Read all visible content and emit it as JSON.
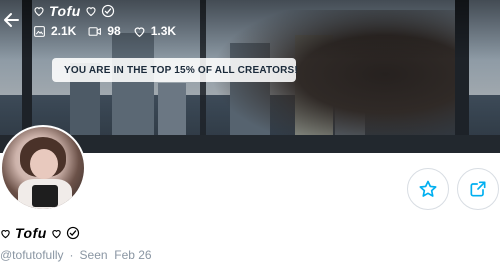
{
  "header": {
    "display_name": "Tofu",
    "stats": {
      "photos": "2.1K",
      "videos": "98",
      "likes": "1.3K"
    }
  },
  "banner": {
    "rank_text": "YOU ARE IN THE TOP 15% OF ALL CREATORS!"
  },
  "profile": {
    "display_name": "Tofu",
    "username": "@tofutofully",
    "separator": "·",
    "last_seen": "Seen  Feb 26"
  },
  "colors": {
    "accent": "#00aff0",
    "muted_text": "#8a96a3",
    "border": "#d8dde3"
  },
  "icons": [
    "back-arrow-icon",
    "heart-icon",
    "verified-icon",
    "image-icon",
    "video-icon",
    "star-icon",
    "share-icon"
  ]
}
